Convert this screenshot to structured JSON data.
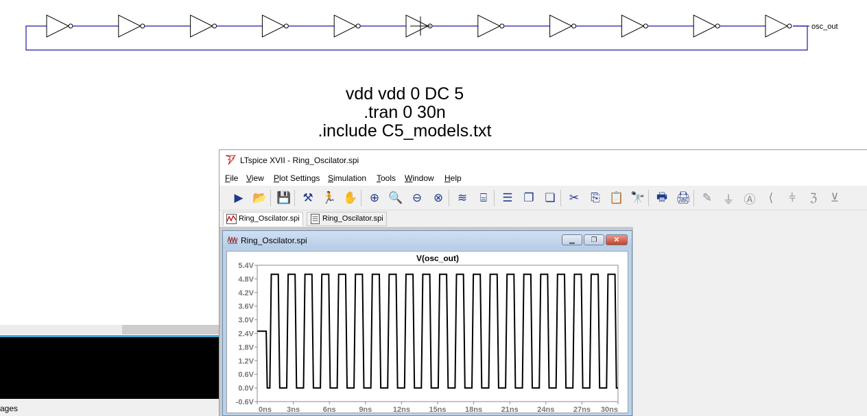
{
  "schematic": {
    "net_label": "osc_out",
    "inverter_count": 11,
    "wire_color": "#1a1aa0",
    "netlist_lines": [
      "vdd vdd 0 DC 5",
      ".tran 0 30n",
      ".include C5_models.txt"
    ]
  },
  "left_panel": {
    "status_text": "ages"
  },
  "ltspice": {
    "title": "LTspice XVII - Ring_Oscilator.spi",
    "menu": [
      {
        "key": "F",
        "rest": "ile"
      },
      {
        "key": "V",
        "rest": "iew"
      },
      {
        "key": "P",
        "rest": "lot Settings"
      },
      {
        "key": "S",
        "rest": "imulation"
      },
      {
        "key": "T",
        "rest": "ools"
      },
      {
        "key": "W",
        "rest": "indow"
      },
      {
        "key": "H",
        "rest": "elp"
      }
    ],
    "toolbar": [
      {
        "name": "run-icon",
        "glyph": "▶"
      },
      {
        "name": "open-icon",
        "glyph": "📂"
      },
      {
        "name": "save-icon",
        "glyph": "💾"
      },
      {
        "name": "control-panel-icon",
        "glyph": "⚒"
      },
      {
        "name": "run-man-icon",
        "glyph": "🏃"
      },
      {
        "name": "pan-hand-icon",
        "glyph": "✋"
      },
      {
        "name": "zoom-in-icon",
        "glyph": "⊕"
      },
      {
        "name": "zoom-fit-icon",
        "glyph": "🔍"
      },
      {
        "name": "zoom-out-icon",
        "glyph": "⊖"
      },
      {
        "name": "zoom-cancel-icon",
        "glyph": "⊗"
      },
      {
        "name": "autorange-icon",
        "glyph": "≋"
      },
      {
        "name": "pick-visible-traces-icon",
        "glyph": "⌸"
      },
      {
        "name": "tile-horizontal-icon",
        "glyph": "☰"
      },
      {
        "name": "cascade-icon",
        "glyph": "❐"
      },
      {
        "name": "tile-vertical-icon",
        "glyph": "❏"
      },
      {
        "name": "cut-icon",
        "glyph": "✂"
      },
      {
        "name": "copy-icon",
        "glyph": "⎘"
      },
      {
        "name": "paste-icon",
        "glyph": "📋"
      },
      {
        "name": "find-icon",
        "glyph": "🔭"
      },
      {
        "name": "print-icon",
        "glyph": "🖶"
      },
      {
        "name": "print-setup-icon",
        "glyph": "🖨"
      },
      {
        "name": "wire-icon",
        "glyph": "✎"
      },
      {
        "name": "ground-icon",
        "glyph": "⏚"
      },
      {
        "name": "label-net-icon",
        "glyph": "Ⓐ"
      },
      {
        "name": "resistor-icon",
        "glyph": "⟨"
      },
      {
        "name": "capacitor-icon",
        "glyph": "⫩"
      },
      {
        "name": "inductor-icon",
        "glyph": "ℨ"
      },
      {
        "name": "diode-icon",
        "glyph": "⊻"
      }
    ],
    "tabs": [
      {
        "label": "Ring_Oscilator.spi",
        "icon": "waveform-tab-icon"
      },
      {
        "label": "Ring_Oscilator.spi",
        "icon": "netlist-tab-icon"
      }
    ],
    "wave_window": {
      "title": "Ring_Oscilator.spi"
    }
  },
  "chart_data": {
    "type": "line",
    "title": "V(osc_out)",
    "xlabel": "",
    "ylabel": "",
    "x_ticks": [
      "0ns",
      "3ns",
      "6ns",
      "9ns",
      "12ns",
      "15ns",
      "18ns",
      "21ns",
      "24ns",
      "27ns",
      "30ns"
    ],
    "y_ticks": [
      "5.4V",
      "4.8V",
      "4.2V",
      "3.6V",
      "3.0V",
      "2.4V",
      "1.8V",
      "1.2V",
      "0.6V",
      "0.0V",
      "-0.6V"
    ],
    "xlim": [
      0,
      30
    ],
    "ylim": [
      -0.6,
      5.4
    ],
    "x_unit": "ns",
    "y_unit": "V",
    "series": [
      {
        "color": "#000000",
        "initial_level": 2.5,
        "start_time": 0.75,
        "high": 5.0,
        "low": 0.0,
        "period": 1.4,
        "duty": 0.5
      }
    ]
  }
}
